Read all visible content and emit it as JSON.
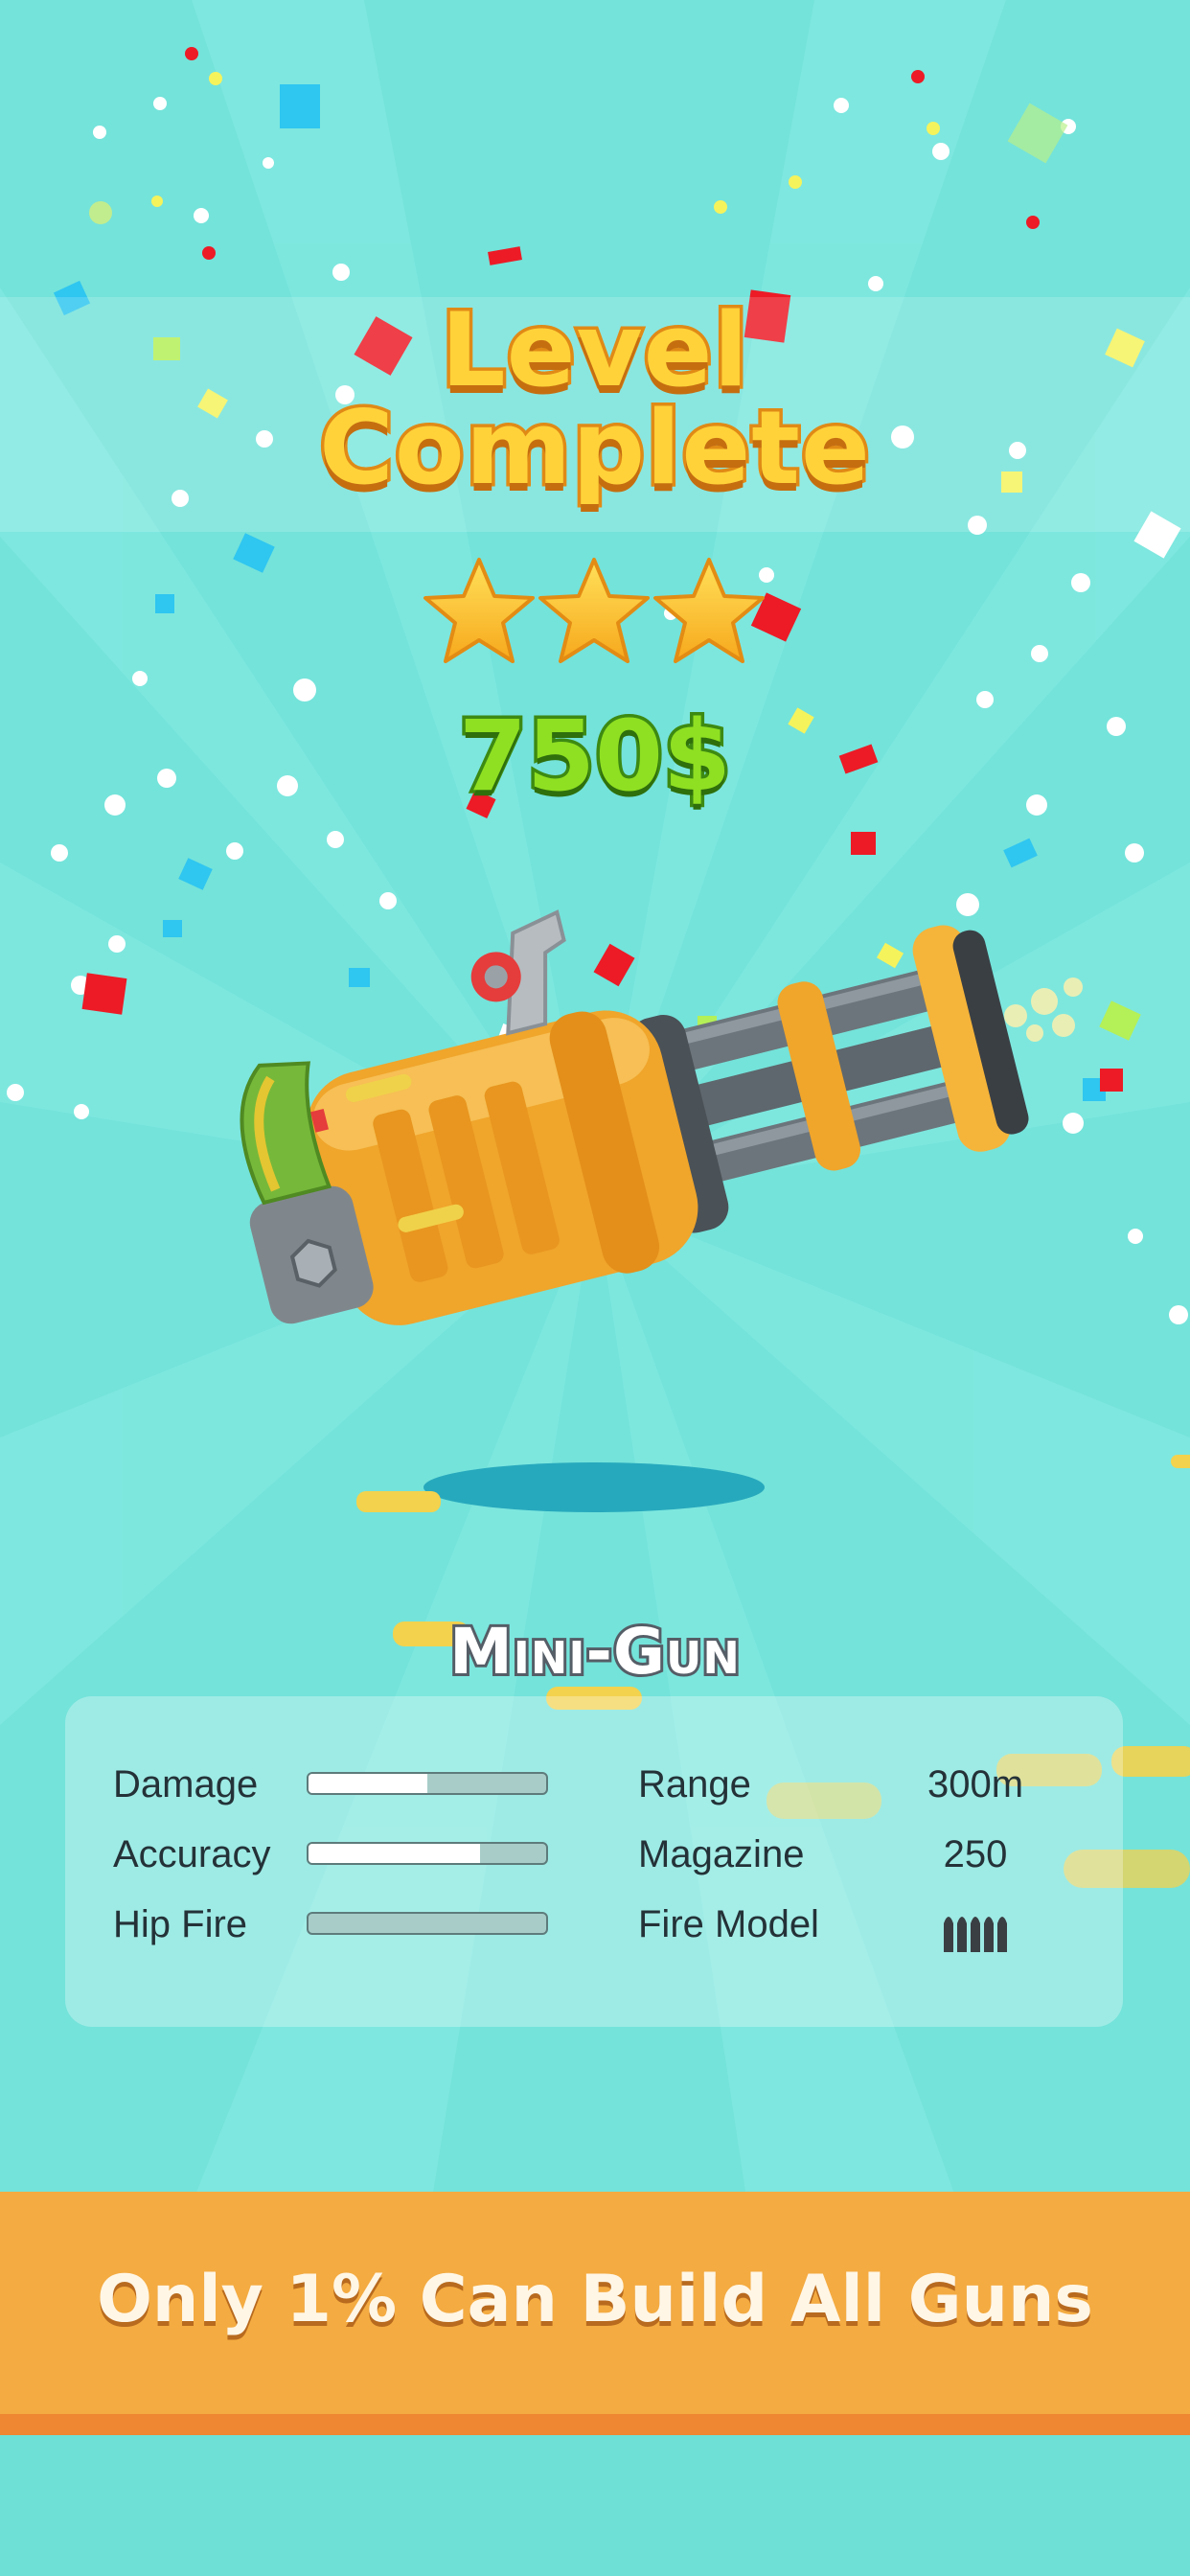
{
  "header": {
    "title_line1": "Level",
    "title_line2": "Complete",
    "stars_earned": 3,
    "stars_total": 3,
    "reward": "750$"
  },
  "weapon": {
    "name": "Mini-Gun",
    "image": "minigun-illustration"
  },
  "stats": {
    "damage": {
      "label": "Damage",
      "fill": 0.5
    },
    "accuracy": {
      "label": "Accuracy",
      "fill": 0.72
    },
    "hip_fire": {
      "label": "Hip Fire",
      "fill": 0.0
    },
    "range": {
      "label": "Range",
      "value": "300m"
    },
    "magazine": {
      "label": "Magazine",
      "value": "250"
    },
    "fire_model": {
      "label": "Fire Model",
      "icon": "burst-bullets-icon"
    }
  },
  "banner": {
    "text": "Only 1% Can Build All Guns"
  },
  "colors": {
    "background": "#74e3da",
    "title_fill": "#ffd23a",
    "reward_fill": "#8fe022",
    "banner": "#f4ab41",
    "banner_stripe": "#ef8632"
  }
}
